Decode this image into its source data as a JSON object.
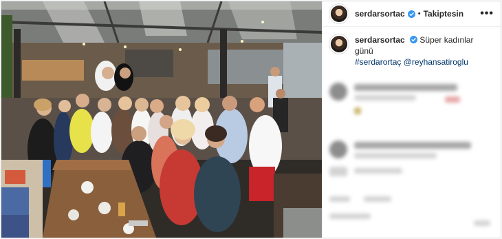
{
  "post": {
    "username": "serdarsortac",
    "follow_status": "Takiptesin",
    "separator": "•",
    "more_label": "•••"
  },
  "caption": {
    "username": "serdarsortac",
    "text": "Süper kadınlar günü",
    "hashtag": "#serdarortaç",
    "mention": "@reyhansatiroglu"
  },
  "colors": {
    "link": "#003569",
    "verified": "#3897f0",
    "border": "#dbdbdb"
  },
  "icons": [
    "verified-badge-icon",
    "more-options-icon"
  ]
}
